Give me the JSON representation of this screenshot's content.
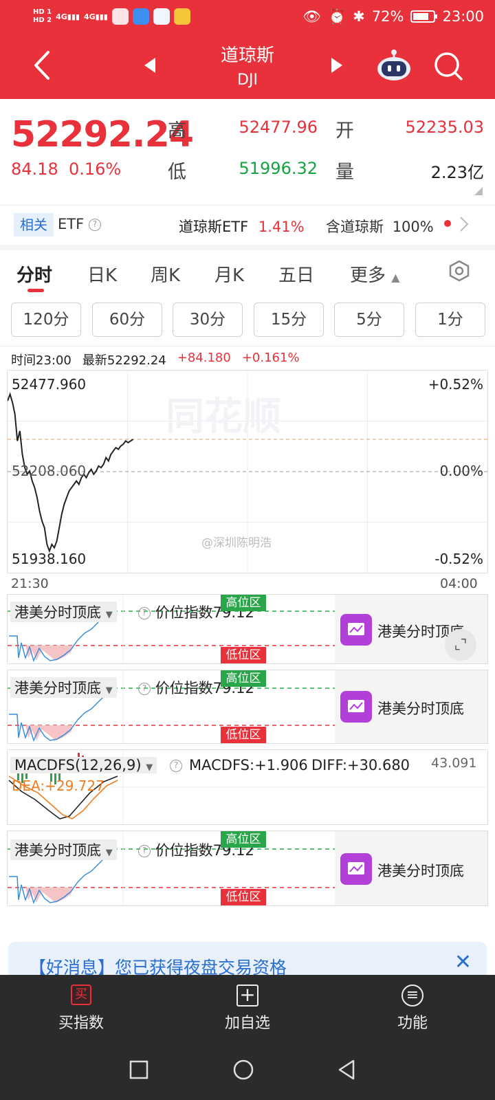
{
  "status": {
    "hd_top": "HD 1",
    "hd_bottom": "HD 2",
    "net1": "4G",
    "net2": "4G",
    "battery": "72%",
    "time": "23:00"
  },
  "header": {
    "title": "道琼斯",
    "subtitle": "DJI"
  },
  "quote": {
    "price": "52292.24",
    "change": "84.18",
    "change_pct": "0.16%",
    "high_label": "高",
    "high": "52477.96",
    "open_label": "开",
    "open": "52235.03",
    "low_label": "低",
    "low": "51996.32",
    "volume_label": "量",
    "volume": "2.23亿"
  },
  "related": {
    "tag": "相关",
    "etf": "ETF",
    "etf_name": "道琼斯ETF",
    "etf_pct": "1.41%",
    "contain": "含道琼斯",
    "contain_pct": "100%"
  },
  "tabs": [
    "分时",
    "日K",
    "周K",
    "月K",
    "五日",
    "更多"
  ],
  "intervals": [
    "120分",
    "60分",
    "30分",
    "15分",
    "5分",
    "1分"
  ],
  "info_bar": {
    "time": "时间23:00",
    "latest": "最新52292.24",
    "change": "+84.180",
    "pct": "+0.161%"
  },
  "chart_data": {
    "type": "line",
    "y_top_label": "52477.960",
    "y_mid_label": "52208.060",
    "y_bottom_label": "51938.160",
    "pct_top": "+0.52%",
    "pct_mid": "0.00%",
    "pct_bottom": "-0.52%",
    "x_start": "21:30",
    "x_end": "04:00",
    "ylim": [
      51938.16,
      52477.96
    ],
    "previous_close": 52208.06,
    "grid": true,
    "x": [
      0,
      2,
      4,
      6,
      8,
      10,
      12,
      14,
      16,
      18,
      20,
      22,
      24,
      26,
      28,
      30,
      32,
      34,
      36,
      38,
      40,
      42,
      44,
      46,
      48,
      50,
      52,
      54,
      56,
      58,
      60,
      62,
      64,
      66,
      68,
      70,
      72,
      74,
      76,
      78,
      80,
      82,
      84,
      86,
      88,
      90,
      92,
      94,
      96,
      98,
      100,
      102
    ],
    "values": [
      52420,
      52440,
      52415,
      52380,
      52300,
      52330,
      52260,
      52220,
      52200,
      52210,
      52180,
      52160,
      52130,
      52090,
      52060,
      52040,
      51990,
      51970,
      51990,
      51980,
      52000,
      52040,
      52080,
      52110,
      52130,
      52150,
      52160,
      52170,
      52180,
      52170,
      52190,
      52200,
      52190,
      52205,
      52215,
      52200,
      52210,
      52225,
      52220,
      52230,
      52250,
      52240,
      52260,
      52270,
      52280,
      52275,
      52285,
      52290,
      52300,
      52295,
      52300,
      52305
    ],
    "xlim": [
      0,
      390
    ],
    "watermark": "@深圳陈明浩"
  },
  "panels": {
    "indicator": {
      "name": "港美分时顶底",
      "index_text": "价位指数79.12",
      "high_zone": "高位区",
      "low_zone": "低位区",
      "badge": "港美分时顶底"
    },
    "macd": {
      "name": "MACDFS(12,26,9)",
      "macdfs": "MACDFS:+1.906",
      "diff": "DIFF:+30.680",
      "dea": "DEA:+29.727",
      "max": "43.091"
    }
  },
  "banner": {
    "text": "【好消息】您已获得夜盘交易资格"
  },
  "bottom_nav": [
    {
      "icon": "买",
      "label": "买指数"
    },
    {
      "label": "加自选"
    },
    {
      "label": "功能"
    }
  ],
  "colors": {
    "red": "#e8313a",
    "green": "#13a340",
    "blue": "#2a6fd0",
    "line": "#222222"
  }
}
